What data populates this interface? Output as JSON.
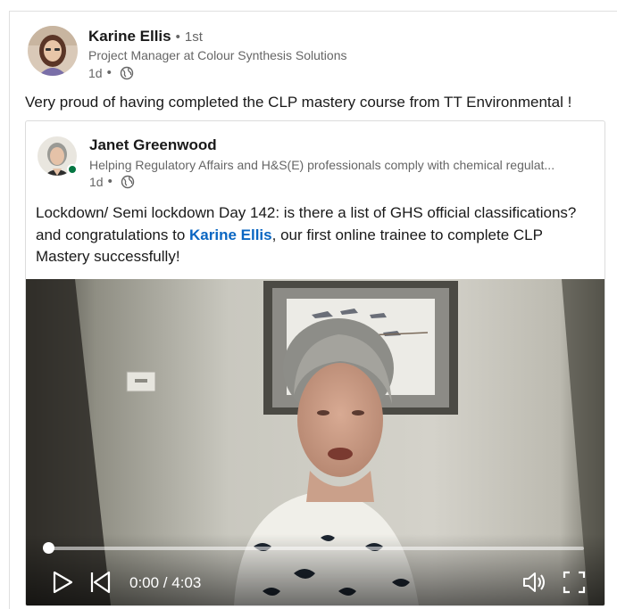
{
  "post": {
    "actor": {
      "name": "Karine Ellis",
      "degree": "1st",
      "headline": "Project Manager at Colour Synthesis Solutions",
      "time": "1d",
      "visibility_icon": "globe-icon"
    },
    "commentary": "Very proud of having completed the CLP mastery course from TT Environmental !"
  },
  "shared": {
    "actor": {
      "name": "Janet Greenwood",
      "headline": "Helping Regulatory Affairs and H&S(E) professionals comply with chemical regulat...",
      "time": "1d",
      "online": true
    },
    "text_before": "Lockdown/ Semi lockdown Day 142: is there a list of GHS official classifications? and congratulations to ",
    "mention": "Karine Ellis",
    "text_after": ", our first online trainee to complete CLP Mastery successfully!"
  },
  "video": {
    "time_display": "0:00 / 4:03",
    "progress": 0,
    "icons": [
      "play-icon",
      "replay-icon",
      "volume-icon",
      "fullscreen-icon"
    ]
  },
  "colors": {
    "link": "#0a66c2",
    "online": "#057642",
    "secondary_text": "#666666"
  }
}
